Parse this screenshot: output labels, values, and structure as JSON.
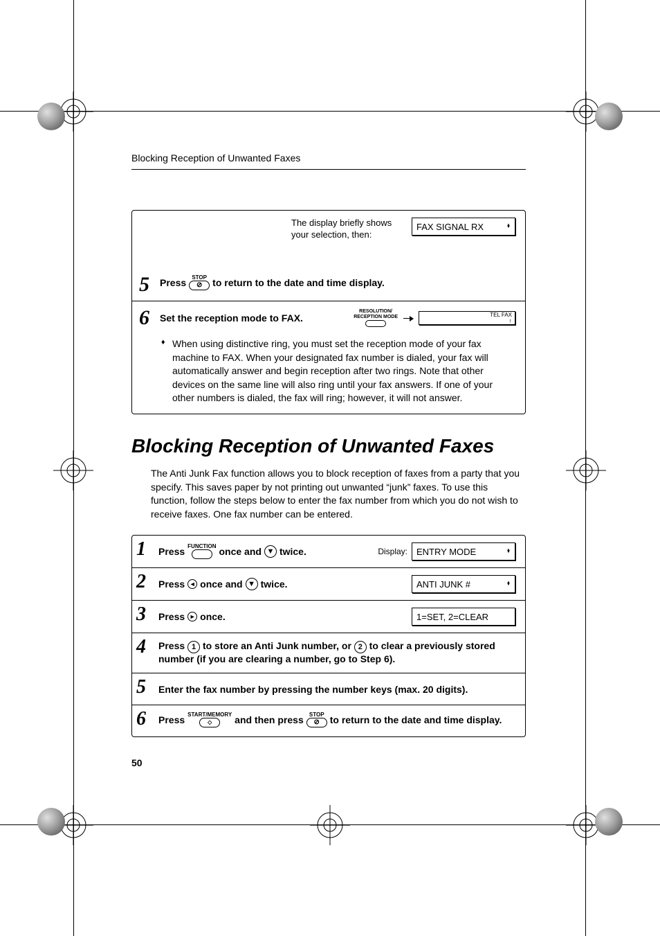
{
  "running_head": "Blocking Reception of Unwanted Faxes",
  "toprow": {
    "text1": "The display briefly shows",
    "text2": "your selection, then:"
  },
  "lcd": {
    "fax_signal": "FAX SIGNAL RX",
    "tel_fax": "TEL  FAX",
    "entry_mode": "ENTRY MODE",
    "anti_junk": "ANTI JUNK #",
    "set_clear": "1=SET, 2=CLEAR"
  },
  "buttons": {
    "stop": "STOP",
    "stop_icon": "⊘",
    "function": "FUNCTION",
    "start_memory": "START/MEMORY",
    "start_icon": "◁▷",
    "resolution": "RESOLUTION/",
    "reception_mode": "RECEPTION MODE",
    "down_arrow": "▼",
    "left_arrow": "◄",
    "right_arrow": "►",
    "key1": "1",
    "key2": "2",
    "uparrow": "↑"
  },
  "stepsA": {
    "s5a": "Press",
    "s5b": "to return to the date and time display.",
    "s6a": "Set the reception mode to FAX."
  },
  "bullet": "When using distinctive ring, you must set the reception mode of your fax machine to FAX. When your designated fax number is dialed, your fax will automatically answer and begin reception after two rings. Note that other devices on the same line will also ring until your fax answers. If one of your other numbers is dialed, the fax will ring; however, it will not answer.",
  "section_title": "Blocking Reception of Unwanted Faxes",
  "intro": "The Anti Junk Fax function allows you to block reception of faxes from a party that you specify. This saves paper by not printing out unwanted “junk” faxes. To use this function, follow the steps below to enter the fax number from which you do not wish to receive faxes. One fax number can be entered.",
  "stepsB": {
    "s1a": "Press",
    "s1b": "once and",
    "s1c": "twice.",
    "display_label": "Display:",
    "s2a": "Press",
    "s2b": "once and",
    "s2c": "twice.",
    "s3a": "Press",
    "s3b": "once.",
    "s4a": "Press",
    "s4b": "to store an Anti Junk number, or",
    "s4c": "to clear a previously stored number (if you are clearing a number, go to Step 6).",
    "s5": "Enter the fax number by pressing the number keys (max. 20 digits).",
    "s6a": "Press",
    "s6b": "and then press",
    "s6c": "to return to the date and time display."
  },
  "page_number": "50"
}
